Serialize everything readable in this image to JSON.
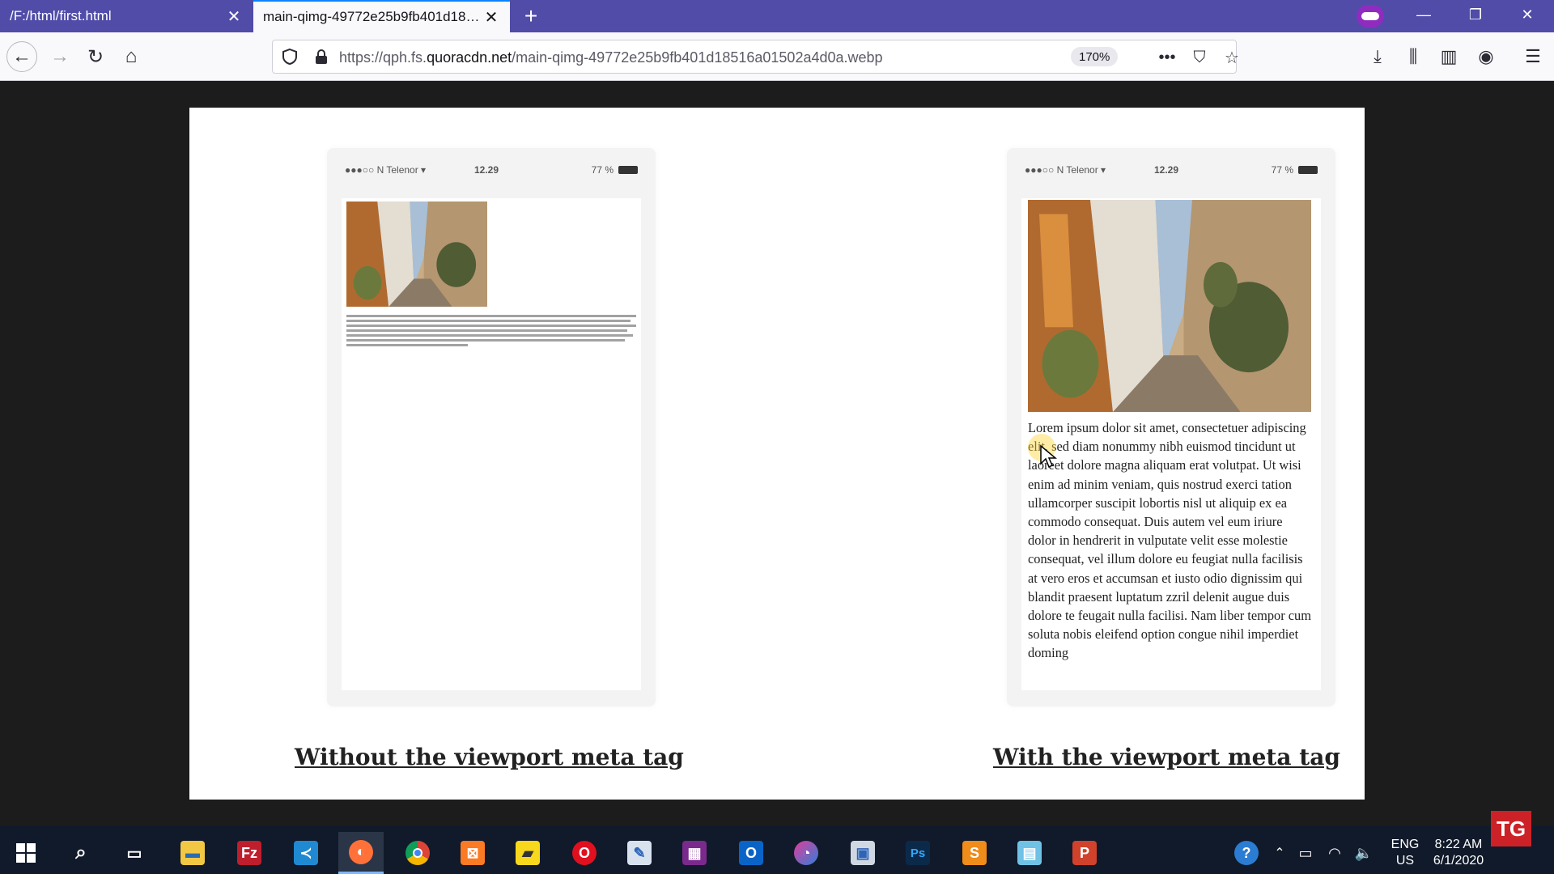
{
  "browser": {
    "tabs": [
      {
        "title": "/F:/html/first.html"
      },
      {
        "title": "main-qimg-49772e25b9fb401d18516"
      }
    ],
    "url_prefix": "https://qph.fs.",
    "url_domain": "quoracdn.net",
    "url_path": "/main-qimg-49772e25b9fb401d18516a01502a4d0a.webp",
    "zoom": "170%",
    "icons": {
      "back": "back-arrow-icon",
      "forward": "forward-arrow-icon",
      "reload": "reload-icon",
      "home": "home-icon",
      "shield": "shield-icon",
      "lock": "lock-icon",
      "more": "more-icon",
      "pocket": "pocket-icon",
      "star": "star-icon",
      "download": "download-icon",
      "library": "library-icon",
      "sidebar": "sidebar-icon",
      "account": "account-icon",
      "menu": "menu-icon"
    }
  },
  "image": {
    "left_phone": {
      "carrier": "●●●○○ N Telenor ▾",
      "time": "12.29",
      "battery": "77 %"
    },
    "right_phone": {
      "carrier": "●●●○○ N Telenor ▾",
      "time": "12.29",
      "battery": "77 %",
      "body_text": "Lorem ipsum dolor sit amet, consectetuer adipiscing elit, sed diam nonummy nibh euismod tincidunt ut laoreet dolore magna aliquam erat volutpat. Ut wisi enim ad minim veniam, quis nostrud exerci tation ullamcorper suscipit lobortis nisl ut aliquip ex ea commodo consequat. Duis autem vel eum iriure dolor in hendrerit in vulputate velit esse molestie consequat, vel illum dolore eu feugiat nulla facilisis at vero eros et accumsan et iusto odio dignissim qui blandit praesent luptatum zzril delenit augue duis dolore te feugait nulla facilisi. Nam liber tempor cum soluta nobis eleifend option congue nihil imperdiet doming"
    },
    "caption_left": "Without the viewport meta tag",
    "caption_right": "With the viewport meta tag"
  },
  "taskbar": {
    "apps": [
      "start",
      "search",
      "task-view",
      "file-explorer",
      "filezilla",
      "vscode",
      "firefox",
      "chrome",
      "xampp",
      "sticky-notes",
      "opera",
      "paint",
      "winrar",
      "outlook",
      "paint-3d",
      "screen-capture",
      "photoshop",
      "sublime-text",
      "notepad",
      "powerpoint"
    ],
    "lang_top": "ENG",
    "lang_bottom": "US",
    "time": "8:22 AM",
    "date": "6/1/2020",
    "watermark": "TG"
  }
}
